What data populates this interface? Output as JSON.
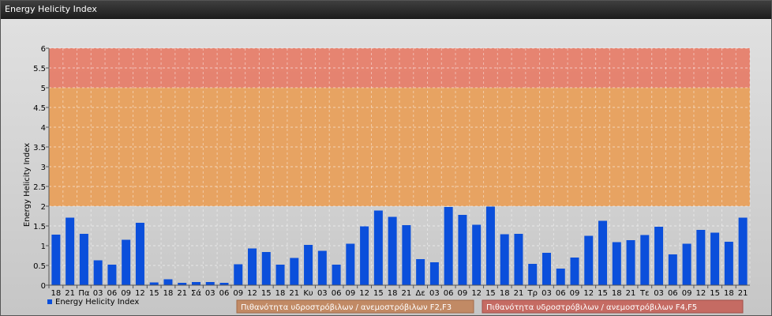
{
  "window": {
    "title": "Energy Helicity Index"
  },
  "chart_data": {
    "type": "bar",
    "title": "",
    "xlabel": "",
    "ylabel": "Energy Helicity Index",
    "ylim": [
      0,
      6
    ],
    "yticks": [
      "0",
      "0.5",
      "1",
      "1.5",
      "2",
      "2.5",
      "3",
      "3.5",
      "4",
      "4.5",
      "5",
      "5.5",
      "6"
    ],
    "grid": true,
    "legend_position": "bottom-left",
    "categories": [
      "18",
      "21",
      "Πα",
      "03",
      "06",
      "09",
      "12",
      "15",
      "18",
      "21",
      "Σά",
      "03",
      "06",
      "09",
      "12",
      "15",
      "18",
      "21",
      "Κυ",
      "03",
      "06",
      "09",
      "12",
      "15",
      "18",
      "21",
      "Δε",
      "03",
      "06",
      "09",
      "12",
      "15",
      "18",
      "21",
      "Τρ",
      "03",
      "06",
      "09",
      "12",
      "15",
      "18",
      "21",
      "Τε",
      "03",
      "06",
      "09",
      "12",
      "15",
      "18",
      "21"
    ],
    "series": [
      {
        "name": "Energy Helicity Index",
        "color": "#0b4fdb",
        "values": [
          1.28,
          1.71,
          1.3,
          0.63,
          0.52,
          1.15,
          1.58,
          0.07,
          0.15,
          0.06,
          0.08,
          0.08,
          0.06,
          0.53,
          0.93,
          0.84,
          0.52,
          0.69,
          1.02,
          0.87,
          0.52,
          1.05,
          1.49,
          1.89,
          1.73,
          1.52,
          0.66,
          0.58,
          1.98,
          1.78,
          1.53,
          1.99,
          1.29,
          1.3,
          0.54,
          0.82,
          0.42,
          0.7,
          1.25,
          1.63,
          1.09,
          1.14,
          1.27,
          1.48,
          0.78,
          1.05,
          1.4,
          1.33,
          1.1,
          1.71
        ]
      }
    ],
    "bands": [
      {
        "from": 2,
        "to": 5,
        "color": "#e8a05c",
        "label": "Πιθανότητα υδροστρόβιλων / ανεμοστρόβιλων F2,F3"
      },
      {
        "from": 5,
        "to": 6,
        "color": "#e67e6a",
        "label": "Πιθανότητα υδροστρόβιλων / ανεμοστρόβιλων F4,F5"
      }
    ]
  }
}
